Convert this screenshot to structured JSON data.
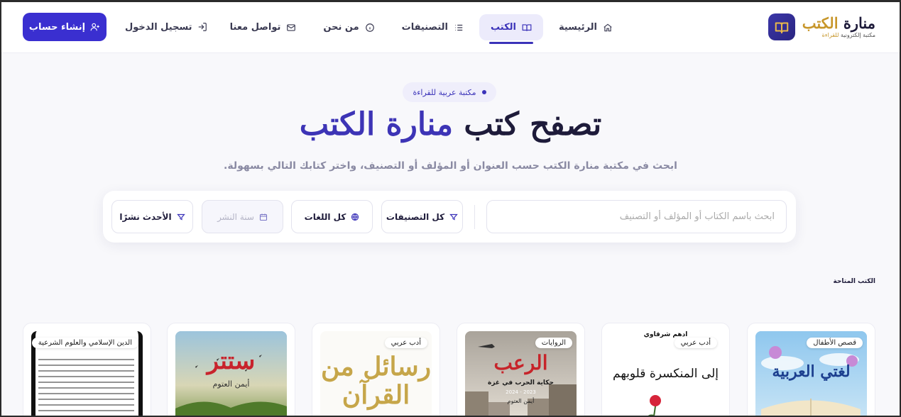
{
  "brand": {
    "title_main": "منارة",
    "title_accent": "الكتب",
    "subtitle_main": "مكتبة إلكترونية",
    "subtitle_accent": "للقراءة"
  },
  "nav": {
    "items": [
      {
        "label": "الرئيسية",
        "icon": "home-icon"
      },
      {
        "label": "الكتب",
        "icon": "book-icon",
        "active": true
      },
      {
        "label": "التصنيفات",
        "icon": "list-icon"
      },
      {
        "label": "من نحن",
        "icon": "info-icon"
      },
      {
        "label": "تواصل معنا",
        "icon": "mail-icon"
      }
    ]
  },
  "auth": {
    "login_label": "تسجيل الدخول",
    "signup_label": "إنشاء حساب"
  },
  "hero": {
    "pill": "مكتبة عربية للقراءة",
    "title_main": "تصفح كتب",
    "title_accent": "منارة الكتب",
    "subtitle": "ابحث في مكتبة منارة الكتب حسب العنوان أو المؤلف أو التصنيف، واختر كتابك التالي بسهولة."
  },
  "search": {
    "placeholder": "ابحث باسم الكتاب أو المؤلف أو التصنيف",
    "category": "كل التصنيفات",
    "language": "كل اللغات",
    "year_placeholder": "سنة النشر",
    "sort": "الأحدث نشرًا"
  },
  "books_section": {
    "label": "الكتب المتاحة",
    "books": [
      {
        "badge": "قصص الأطفال",
        "cover_title": "لغتي العربية",
        "colors": {
          "bg": "#8fc4e8"
        }
      },
      {
        "badge": "أدب عربي",
        "cover_title": "إلى المنكسرة قلوبهم",
        "cover_author": "أدهم شرقاوي",
        "colors": {
          "bg": "#ffffff"
        }
      },
      {
        "badge": "الروايات",
        "cover_title": "الرعب",
        "cover_subtitle": "حكاية الحرب في غزة",
        "cover_author": "أيمن العتوم",
        "cover_years": "2023 - 2024",
        "colors": {
          "bg": "#cfc7bb"
        }
      },
      {
        "badge": "أدب عربي",
        "cover_title": "رسائل من القرآن",
        "colors": {
          "bg": "#fbfaf7"
        }
      },
      {
        "badge": "",
        "cover_title": "ستتر",
        "cover_author": "أيمن العتوم",
        "colors": {
          "bg": "#9fbfd3"
        }
      },
      {
        "badge": "الدين الإسلامي والعلوم الشرعية",
        "cover_title": "",
        "colors": {
          "bg": "#ffffff"
        }
      }
    ]
  }
}
